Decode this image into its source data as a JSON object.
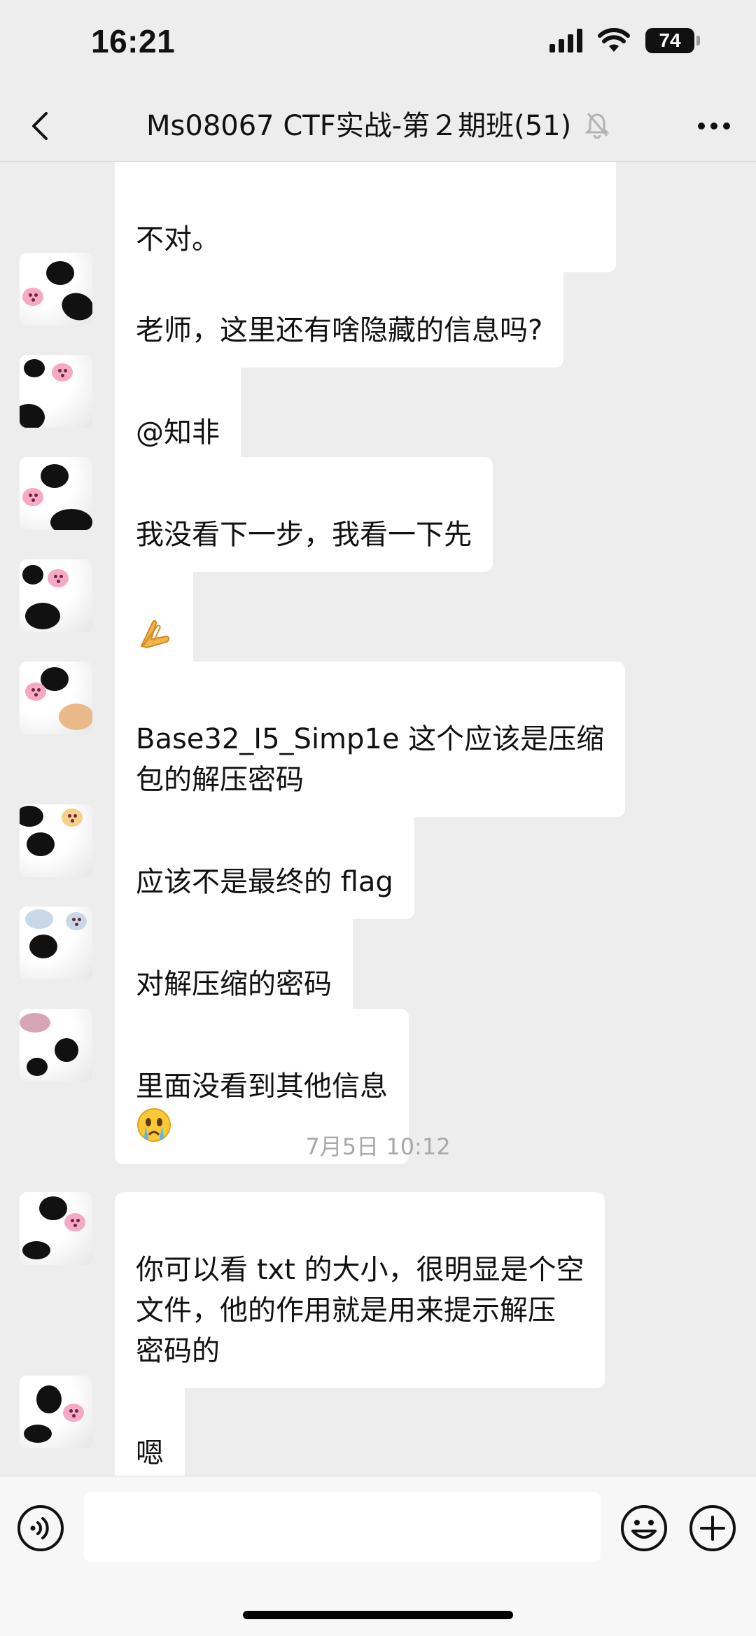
{
  "status_bar": {
    "time": "16:21",
    "battery": "74",
    "icons": [
      "signal-icon",
      "wifi-icon",
      "battery-icon"
    ]
  },
  "nav": {
    "title": "Ms08067 CTF实战-第２期班(51)",
    "icons": [
      "back-icon",
      "mute-bell-icon",
      "more-icon"
    ]
  },
  "messages": [
    {
      "text": "不对。"
    },
    {
      "text": "老师，这里还有啥隐藏的信息吗?"
    },
    {
      "text": "@知非"
    },
    {
      "text": "我没看下一步，我看一下先"
    },
    {
      "text": "",
      "emoji": "folded-hands-emoji"
    },
    {
      "text": "Base32_I5_Simp1e 这个应该是压缩\n包的解压密码"
    },
    {
      "text": "应该不是最终的 flag"
    },
    {
      "text": "对解压缩的密码"
    },
    {
      "text": "里面没看到其他信息",
      "emoji": "crying-face-emoji"
    },
    {
      "text": "你可以看 txt 的大小，很明显是个空\n文件，他的作用就是用来提示解压\n密码的"
    },
    {
      "text": "嗯"
    }
  ],
  "time_divider": "7月5日 10:12",
  "input_bar": {
    "value": "",
    "icons": [
      "voice-icon",
      "emoji-icon",
      "plus-icon"
    ]
  },
  "colors": {
    "background": "#ededed",
    "bubble": "#ffffff",
    "text": "#111111",
    "divider_text": "#a8a8a8",
    "avatar_cheek": "#f6a8c4"
  }
}
